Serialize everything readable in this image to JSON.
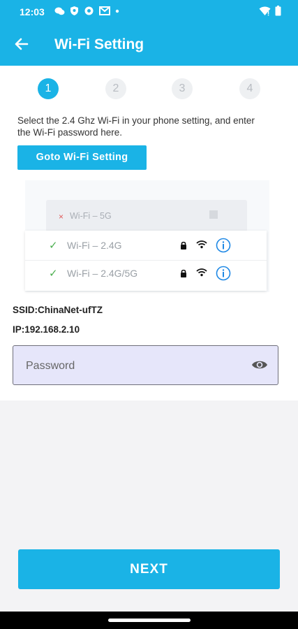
{
  "status_bar": {
    "time": "12:03",
    "icons": [
      "chat-icon",
      "shield-icon",
      "settings-icon",
      "gmail-icon",
      "dot-icon"
    ],
    "right_icons": [
      "wifi-icon",
      "battery-icon"
    ]
  },
  "app_bar": {
    "title": "Wi-Fi Setting",
    "back_icon": "arrow-back-icon"
  },
  "steps": [
    {
      "label": "1",
      "state": "active"
    },
    {
      "label": "2",
      "state": "inactive"
    },
    {
      "label": "3",
      "state": "inactive"
    },
    {
      "label": "4",
      "state": "inactive"
    }
  ],
  "instruction": "Select the 2.4 Ghz Wi-Fi in your phone setting, and enter the Wi-Fi password here.",
  "goto_button": "Goto Wi-Fi Setting",
  "illustration": {
    "rejected": {
      "mark": "×",
      "label": "Wi-Fi – 5G"
    },
    "networks": [
      {
        "mark": "✓",
        "label": "Wi-Fi – 2.4G"
      },
      {
        "mark": "✓",
        "label": "Wi-Fi – 2.4G/5G"
      }
    ]
  },
  "ssid": "SSID:ChinaNet-ufTZ",
  "ip": "IP:192.168.2.10",
  "password": {
    "placeholder": "Password",
    "value": ""
  },
  "next_button": "NEXT",
  "colors": {
    "accent": "#1ab3e6",
    "field_bg": "#e6e6fa",
    "check": "#4caf50",
    "reject": "#e05a5a"
  }
}
